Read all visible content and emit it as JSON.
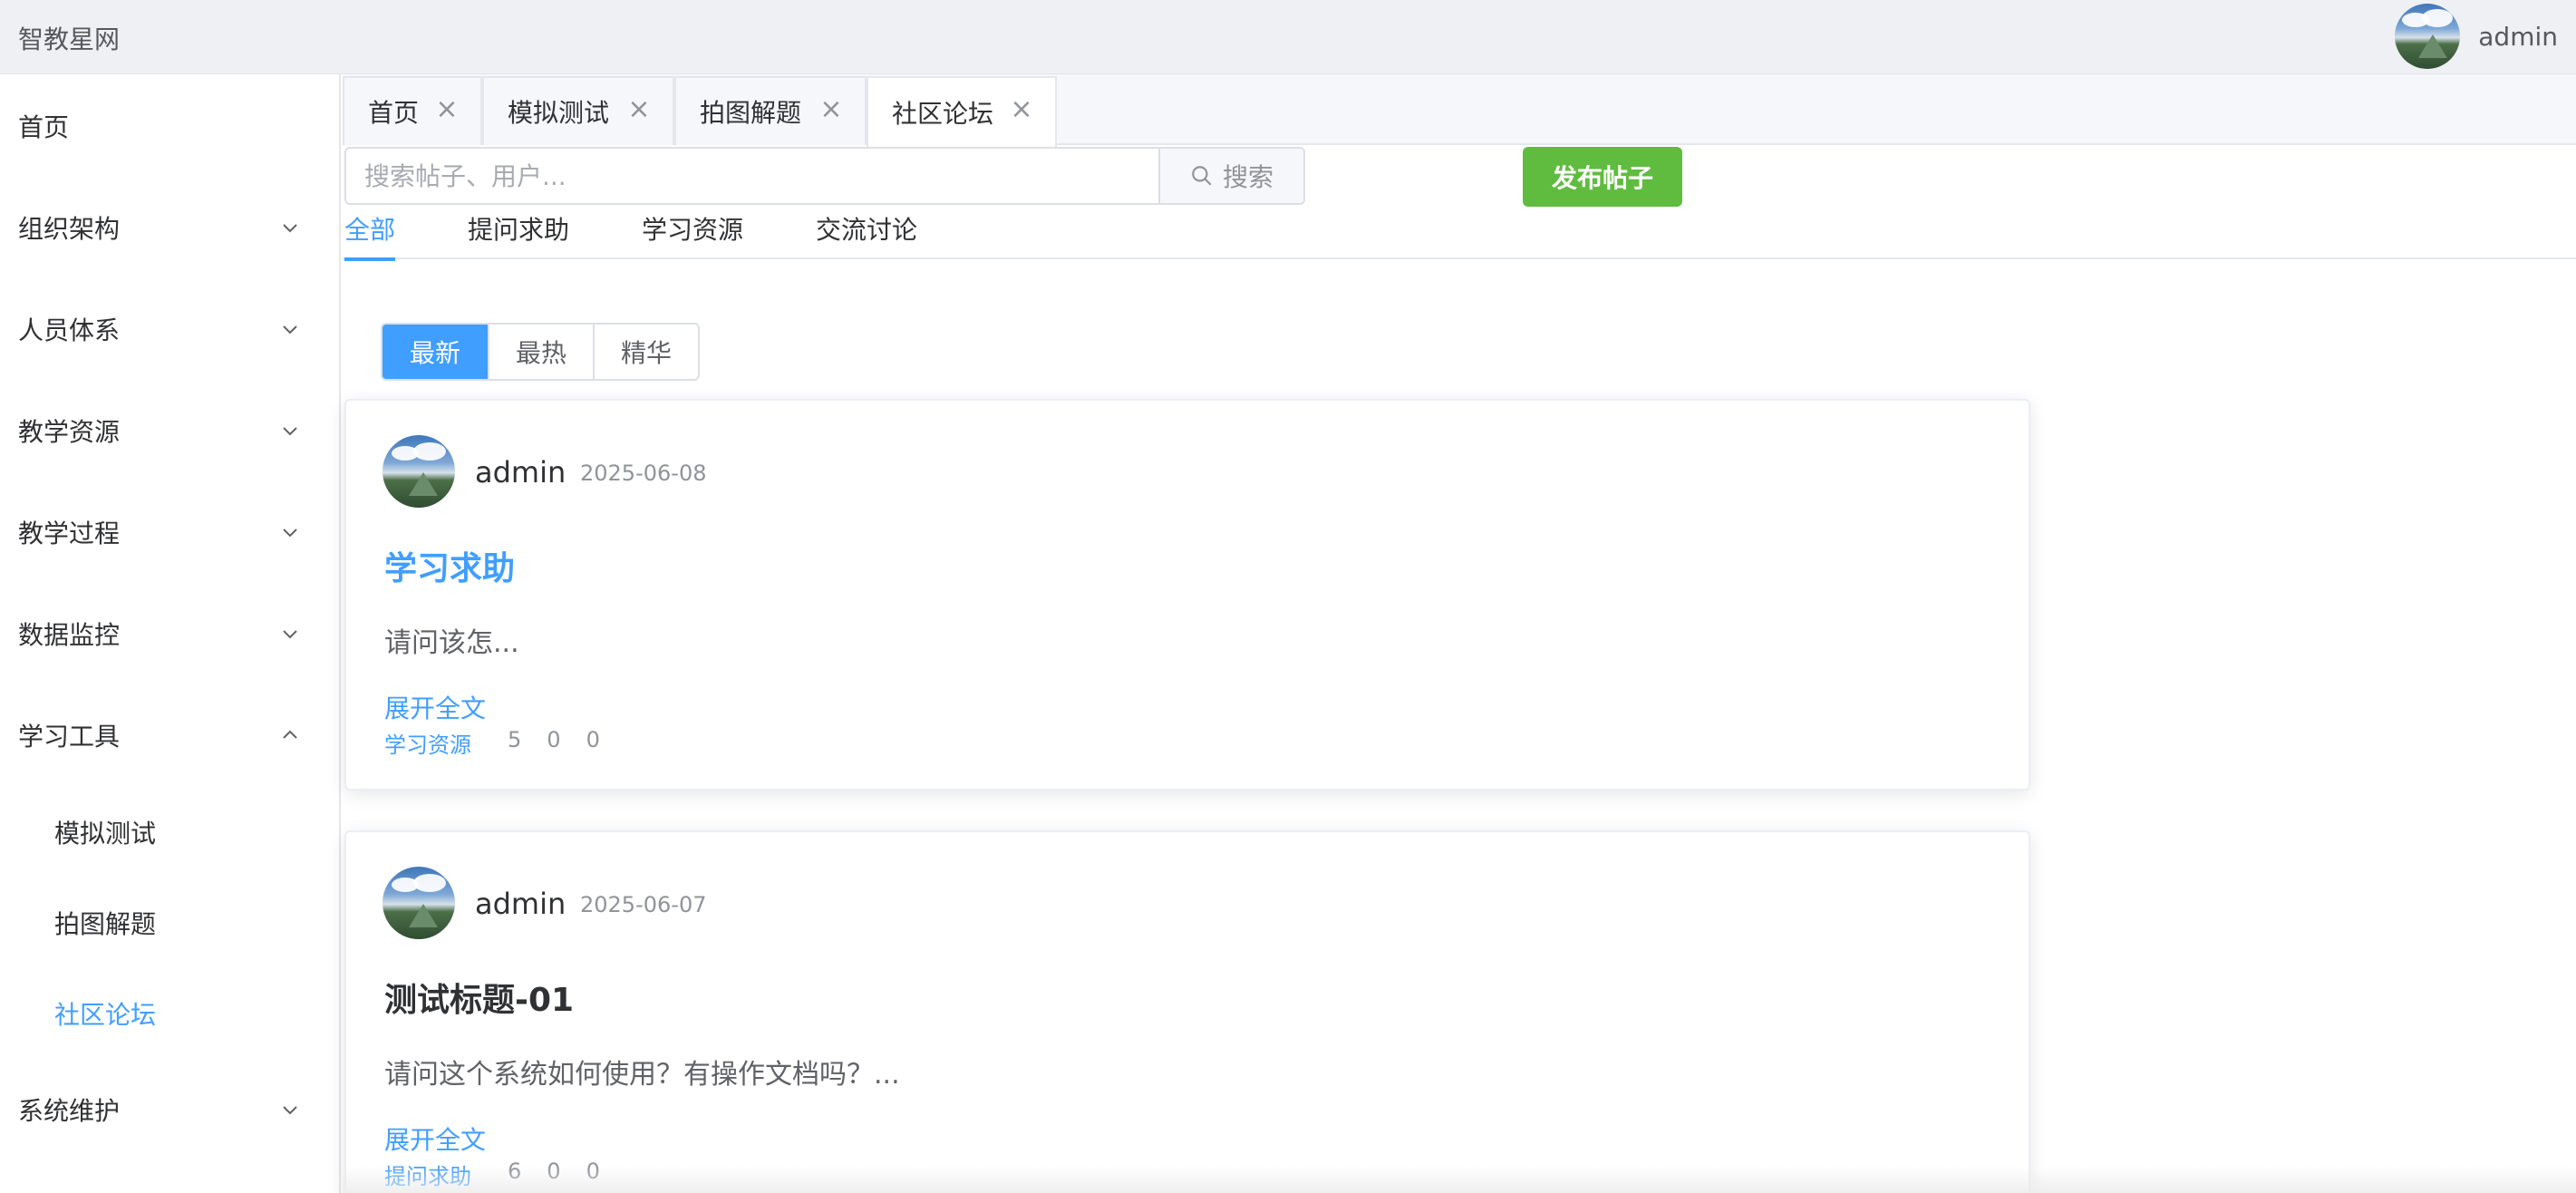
{
  "header": {
    "brand": "智教星网",
    "username": "admin"
  },
  "sidebar": {
    "items": [
      {
        "label": "首页"
      },
      {
        "label": "组织架构"
      },
      {
        "label": "人员体系"
      },
      {
        "label": "教学资源"
      },
      {
        "label": "教学过程"
      },
      {
        "label": "数据监控"
      },
      {
        "label": "学习工具"
      },
      {
        "label": "模拟测试"
      },
      {
        "label": "拍图解题"
      },
      {
        "label": "社区论坛"
      },
      {
        "label": "系统维护"
      }
    ]
  },
  "tabs": [
    {
      "label": "首页"
    },
    {
      "label": "模拟测试"
    },
    {
      "label": "拍图解题"
    },
    {
      "label": "社区论坛"
    }
  ],
  "search": {
    "placeholder": "搜索帖子、用户...",
    "button_label": "搜索"
  },
  "publish_button": "发布帖子",
  "categories": [
    {
      "label": "全部"
    },
    {
      "label": "提问求助"
    },
    {
      "label": "学习资源"
    },
    {
      "label": "交流讨论"
    }
  ],
  "sort": [
    {
      "label": "最新"
    },
    {
      "label": "最热"
    },
    {
      "label": "精华"
    }
  ],
  "posts": [
    {
      "author": "admin",
      "date": "2025-06-08",
      "title": "学习求助",
      "title_color": "#409eff",
      "excerpt": "请问该怎...",
      "expand": "展开全文",
      "category": "学习资源",
      "counts": [
        "5",
        "0",
        "0"
      ]
    },
    {
      "author": "admin",
      "date": "2025-06-07",
      "title": "测试标题-01",
      "title_color": "#303133",
      "excerpt": "请问这个系统如何使用？有操作文档吗？...",
      "expand": "展开全文",
      "category": "提问求助",
      "counts": [
        "6",
        "0",
        "0"
      ]
    }
  ],
  "colors": {
    "accent": "#409eff",
    "publish": "#5fbc3f"
  }
}
